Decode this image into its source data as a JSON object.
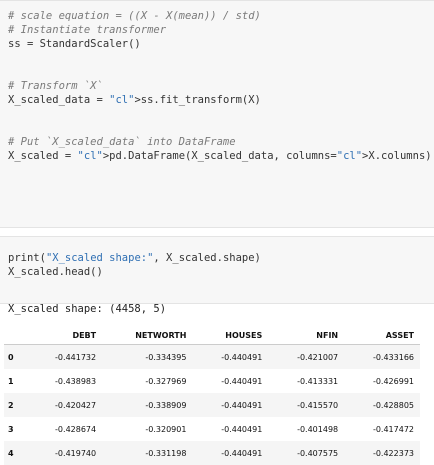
{
  "code_cell_1": {
    "lines": [
      "# scale equation = ((X - X(mean)) / std)",
      "# Instantiate transformer",
      "ss = StandardScaler()",
      "",
      "# Transform `X`",
      "X_scaled_data = ss.fit_transform(X)",
      "",
      "# Put `X_scaled_data` into DataFrame",
      "X_scaled = pd.DataFrame(X_scaled_data, columns=X.columns)"
    ]
  },
  "code_cell_2": {
    "lines": [
      "print(\"X_scaled shape:\", X_scaled.shape)",
      "X_scaled.head()"
    ]
  },
  "output": {
    "shape_text": "X_scaled shape: (4458, 5)"
  },
  "dataframe": {
    "columns": [
      "",
      "DEBT",
      "NETWORTH",
      "HOUSES",
      "NFIN",
      "ASSET"
    ],
    "rows": [
      {
        "index": "0",
        "values": [
          "-0.441732",
          "-0.334395",
          "-0.440491",
          "-0.421007",
          "-0.433166"
        ]
      },
      {
        "index": "1",
        "values": [
          "-0.438983",
          "-0.327969",
          "-0.440491",
          "-0.413331",
          "-0.426991"
        ]
      },
      {
        "index": "2",
        "values": [
          "-0.420427",
          "-0.338909",
          "-0.440491",
          "-0.415570",
          "-0.428805"
        ]
      },
      {
        "index": "3",
        "values": [
          "-0.428674",
          "-0.320901",
          "-0.440491",
          "-0.401498",
          "-0.417472"
        ]
      },
      {
        "index": "4",
        "values": [
          "-0.419740",
          "-0.331198",
          "-0.440491",
          "-0.407575",
          "-0.422373"
        ]
      }
    ]
  }
}
